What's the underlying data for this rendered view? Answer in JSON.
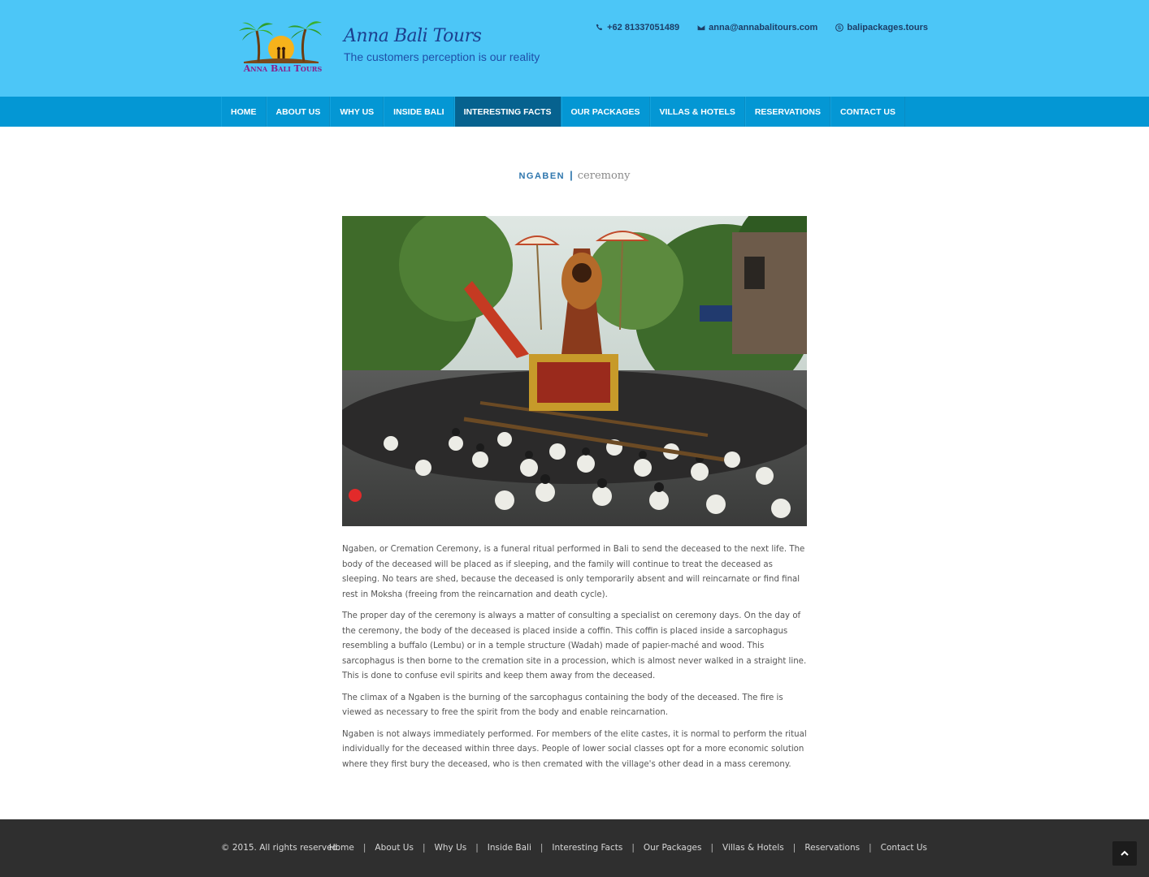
{
  "header": {
    "logo_text": "Anna Bali Tours",
    "brand_name": "Anna Bali Tours",
    "tagline": "The customers perception is our reality",
    "phone": "+62 81337051489",
    "email": "anna@annabalitours.com",
    "skype": "balipackages.tours"
  },
  "nav": {
    "items": [
      {
        "label": "HOME"
      },
      {
        "label": "ABOUT US"
      },
      {
        "label": "WHY US"
      },
      {
        "label": "INSIDE BALI"
      },
      {
        "label": "INTERESTING FACTS",
        "active": true
      },
      {
        "label": "OUR PACKAGES"
      },
      {
        "label": "VILLAS & HOTELS"
      },
      {
        "label": "RESERVATIONS"
      },
      {
        "label": "CONTACT US"
      }
    ]
  },
  "main": {
    "title_strong": "NGABEN",
    "title_sep": "|",
    "title_light": "ceremony",
    "paragraphs": [
      "Ngaben, or Cremation Ceremony, is a funeral ritual performed in Bali to send the deceased to the next life. The body of the deceased will be placed as if sleeping, and the family will continue to treat the deceased as sleeping. No tears are shed, because the deceased is only temporarily absent and will reincarnate or find final rest in Moksha (freeing from the reincarnation and death cycle).",
      "The proper day of the ceremony is always a matter of consulting a specialist on ceremony days. On the day of the ceremony, the body of the deceased is placed inside a coffin. This coffin is placed inside a sarcophagus resembling a buffalo (Lembu) or in a temple structure (Wadah) made of papier-maché and wood. This sarcophagus is then borne to the cremation site in a procession, which is almost never walked in a straight line. This is done to confuse evil spirits and keep them away from the deceased.",
      "The climax of a Ngaben is the burning of the sarcophagus containing the body of the deceased. The fire is viewed as necessary to free the spirit from the body and enable reincarnation.",
      "Ngaben is not always immediately performed. For members of the elite castes, it is normal to perform the ritual individually for the deceased within three days. People of lower social classes opt for a more economic solution where they first bury the deceased, who is then cremated with the village's other dead in a mass ceremony."
    ]
  },
  "footer": {
    "copyright": "© 2015. All rights reserved.",
    "links": [
      "Home",
      "About Us",
      "Why Us",
      "Inside Bali",
      "Interesting Facts",
      "Our Packages",
      "Villas & Hotels",
      "Reservations",
      "Contact Us"
    ],
    "separator": "|"
  },
  "colors": {
    "header_bg": "#4cc6f7",
    "nav_bg": "#0497d4",
    "nav_active": "#06628f",
    "footer_bg": "#2f2f2f",
    "title_accent": "#2e76ad"
  },
  "icons": {
    "phone": "phone-icon",
    "email": "envelope-icon",
    "skype": "skype-icon",
    "back_to_top": "chevron-up-icon"
  }
}
